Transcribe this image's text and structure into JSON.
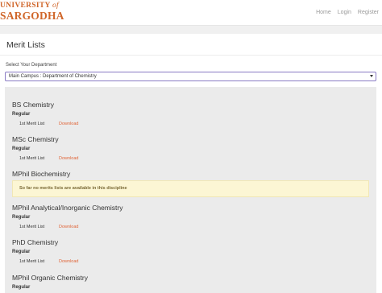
{
  "header": {
    "logo_line1_a": "UNIVERSITY",
    "logo_line1_b": "of",
    "logo_line2": "SARGODHA",
    "nav": [
      "Home",
      "Login",
      "Register"
    ]
  },
  "page": {
    "title": "Merit Lists",
    "dept_label": "Select Your Department",
    "dept_selected": "Main Campus : Department of Chemistry"
  },
  "programs": [
    {
      "title": "BS Chemistry",
      "sub": "Regular",
      "row": "1st Merit List",
      "link": "Download"
    },
    {
      "title": "MSc Chemistry",
      "sub": "Regular",
      "row": "1st Merit List",
      "link": "Download"
    },
    {
      "title": "MPhil Biochemistry",
      "notice": "So far no merits lists are available in this discipline"
    },
    {
      "title": "MPhil Analytical/Inorganic Chemistry",
      "sub": "Regular",
      "row": "1st Merit List",
      "link": "Download"
    },
    {
      "title": "PhD Chemistry",
      "sub": "Regular",
      "row": "1st Merit List",
      "link": "Download"
    },
    {
      "title": "MPhil Organic Chemistry",
      "sub": "Regular"
    }
  ],
  "colors": {
    "brand": "#d0662a",
    "link": "#e0663a",
    "notice_bg": "#fcf6d4",
    "select_border": "#8a7bc4"
  }
}
